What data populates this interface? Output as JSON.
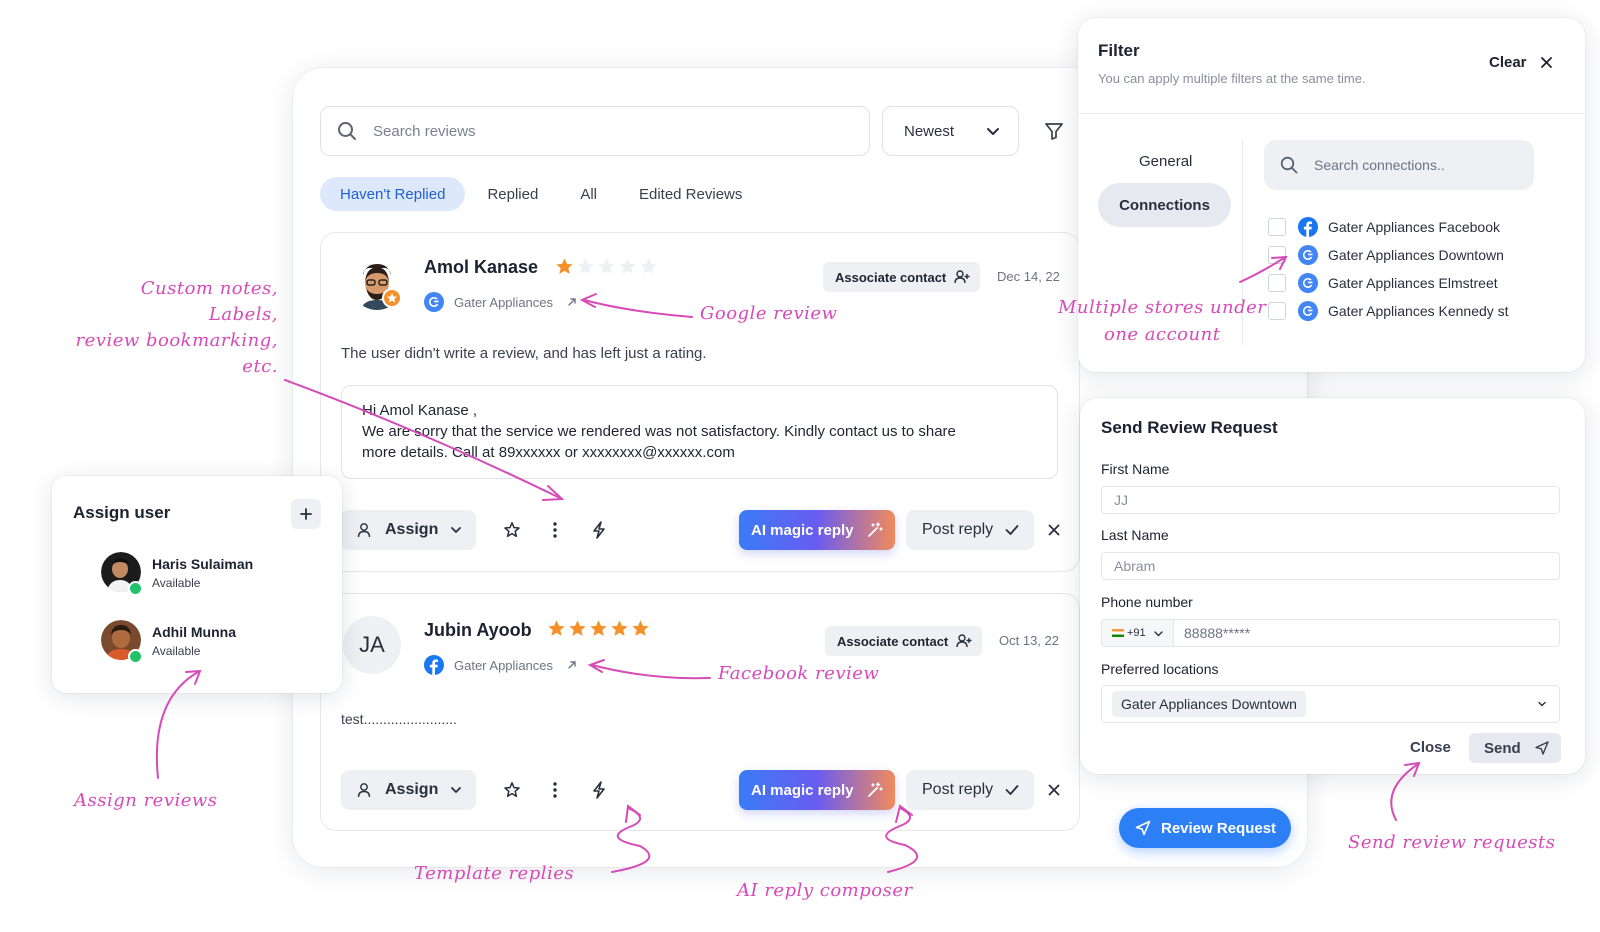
{
  "search": {
    "placeholder": "Search reviews"
  },
  "sort": {
    "value": "Newest"
  },
  "tabs": [
    {
      "label": "Haven't Replied",
      "active": true
    },
    {
      "label": "Replied"
    },
    {
      "label": "All"
    },
    {
      "label": "Edited Reviews"
    }
  ],
  "reviews": [
    {
      "name": "Amol Kanase",
      "rating": 1,
      "source": "Gater Appliances",
      "source_icon": "google-icon",
      "associate_label": "Associate contact",
      "date": "Dec 14, 22",
      "text": "The user didn't write a review, and has left just a rating.",
      "reply_lines": [
        "Hi  Amol Kanase ,",
        "We are sorry that the service we rendered was not satisfactory. Kindly contact us to share",
        "more details. Call at 89xxxxxx or xxxxxxxx@xxxxxx.com"
      ]
    },
    {
      "name": "Jubin Ayoob",
      "initials": "JA",
      "rating": 5,
      "source": "Gater Appliances",
      "source_icon": "facebook-icon",
      "associate_label": "Associate contact",
      "date": "Oct 13, 22",
      "text": "test........................"
    }
  ],
  "actions": {
    "assign_label": "Assign",
    "ai_label": "AI magic reply",
    "post_label": "Post reply"
  },
  "review_request_button": "Review Request",
  "assign_panel": {
    "title": "Assign user",
    "users": [
      {
        "name": "Haris Sulaiman",
        "status": "Available"
      },
      {
        "name": "Adhil Munna",
        "status": "Available"
      }
    ]
  },
  "filter": {
    "title": "Filter",
    "subtitle": "You can apply multiple filters at the same time.",
    "clear_label": "Clear",
    "tabs": [
      "General",
      "Connections"
    ],
    "search_placeholder": "Search connections..",
    "connections": [
      {
        "label": "Gater Appliances Facebook",
        "icon": "facebook-icon"
      },
      {
        "label": "Gater Appliances Downtown",
        "icon": "google-icon"
      },
      {
        "label": "Gater Appliances Elmstreet",
        "icon": "google-icon"
      },
      {
        "label": "Gater Appliances Kennedy st",
        "icon": "google-icon"
      }
    ]
  },
  "send_request": {
    "title": "Send Review Request",
    "first_name_label": "First Name",
    "first_name_value": "JJ",
    "last_name_label": "Last Name",
    "last_name_value": "Abram",
    "phone_label": "Phone number",
    "phone_code": "+91",
    "phone_value": "88888*****",
    "locations_label": "Preferred locations",
    "location_value": "Gater Appliances Downtown",
    "close_label": "Close",
    "send_label": "Send"
  },
  "annotations": {
    "custom_notes": [
      "Custom notes,",
      "Labels,",
      "review bookmarking,",
      "etc."
    ],
    "google_review": "Google review",
    "facebook_review": "Facebook review",
    "multiple_stores": [
      "Multiple stores under",
      "one account"
    ],
    "assign_reviews": "Assign reviews",
    "template_replies": "Template replies",
    "ai_reply": "AI reply composer",
    "send_requests": "Send review requests"
  },
  "colors": {
    "primary_blue": "#2d7ff6",
    "star_orange": "#f5912b",
    "annotation_pink": "#d64bb7",
    "available_green": "#24c16b"
  }
}
